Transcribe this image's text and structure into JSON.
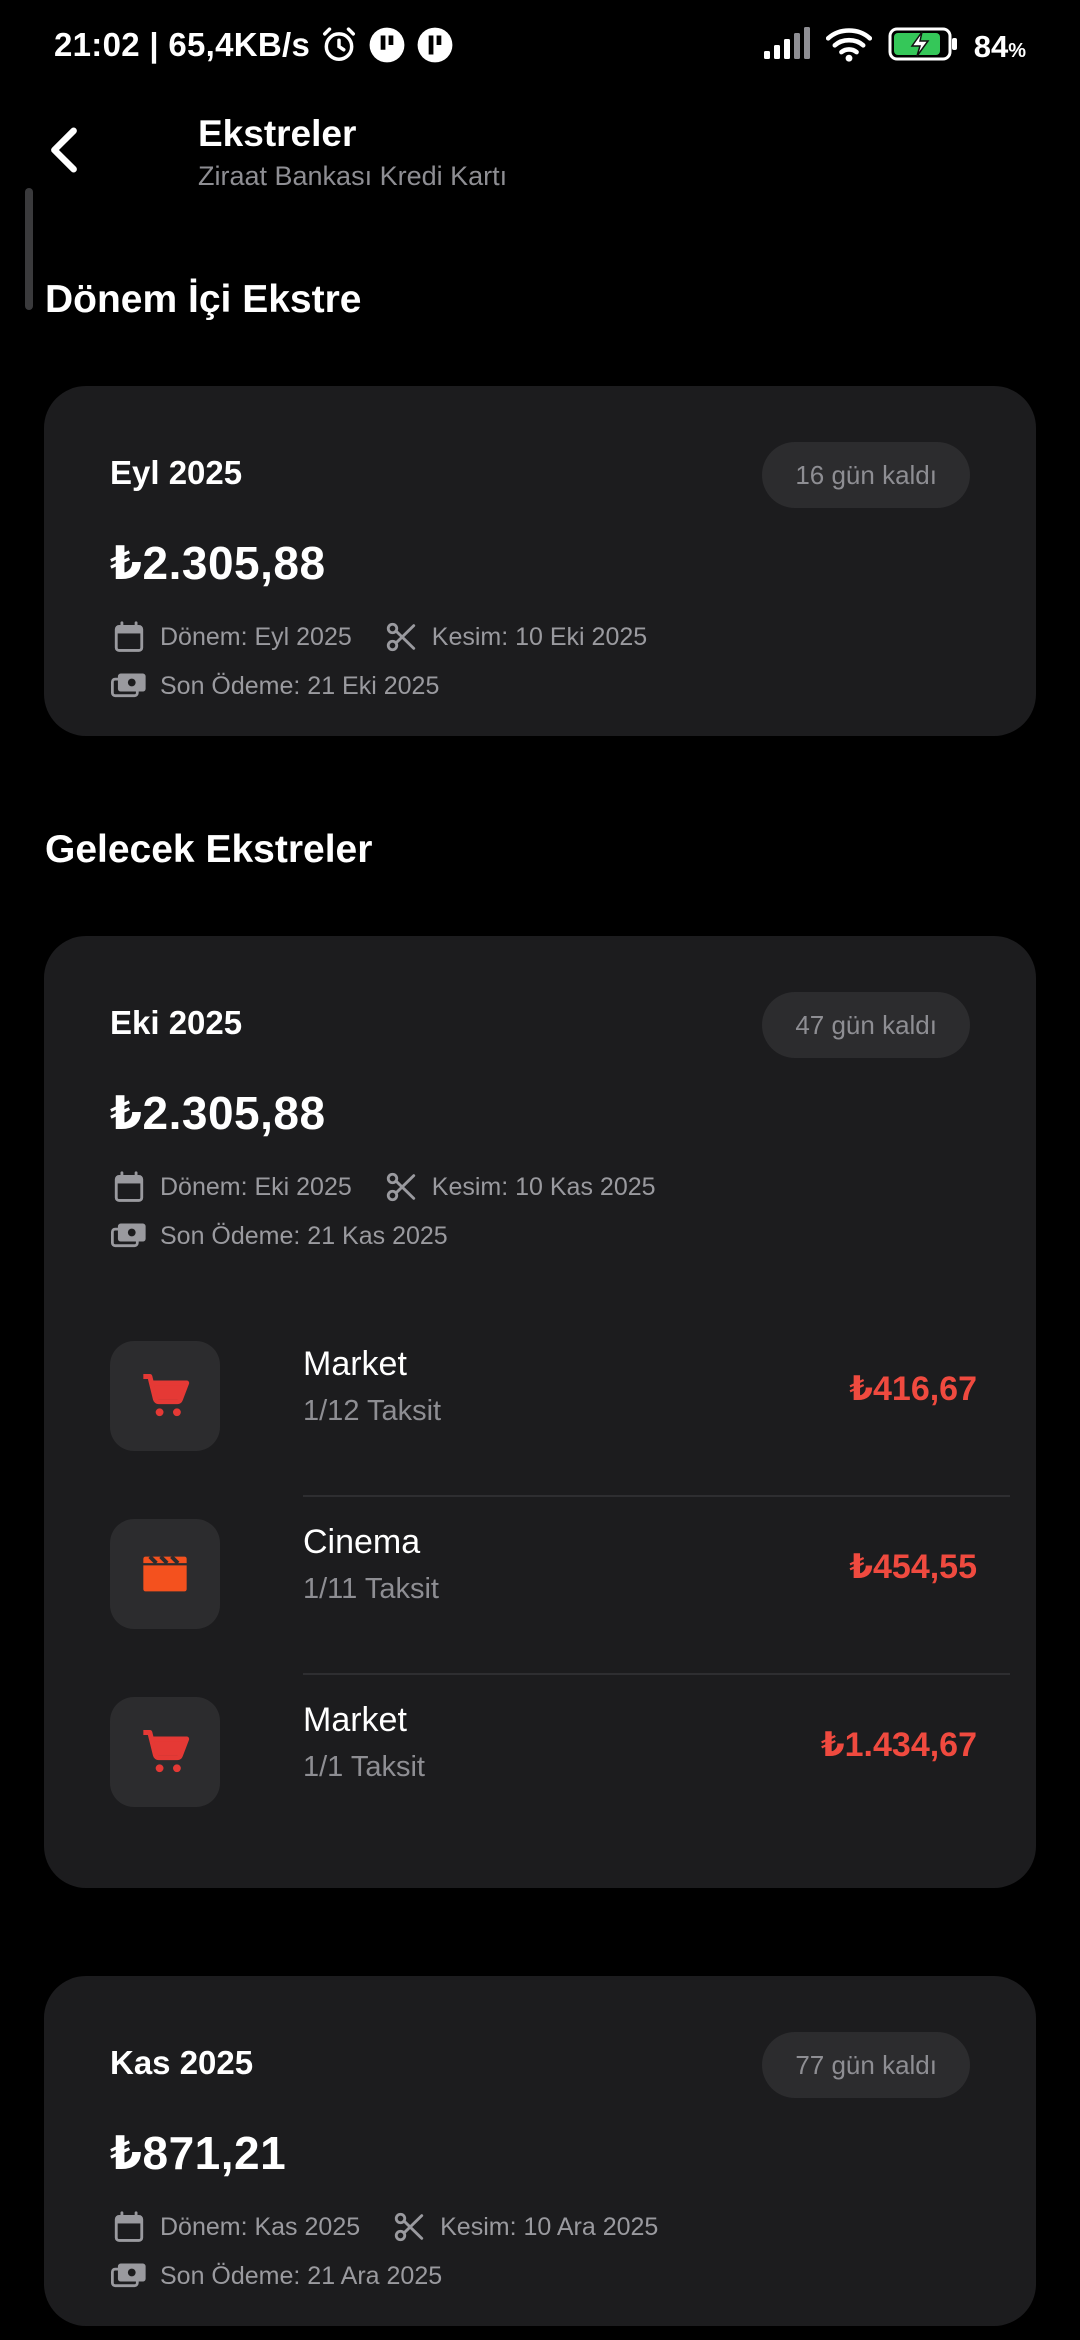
{
  "status_bar": {
    "time_speed": "21:02 | 65,4KB/s",
    "battery": "84",
    "battery_unit": "%"
  },
  "header": {
    "title": "Ekstreler",
    "subtitle": "Ziraat Bankası Kredi Kartı"
  },
  "current_section": {
    "title": "Dönem İçi Ekstre",
    "statement": {
      "period": "Eyl 2025",
      "days_left": "16 gün kaldı",
      "amount": "₺2.305,88",
      "period_line": "Dönem: Eyl 2025",
      "cutoff_line": "Kesim: 10 Eki 2025",
      "due_line": "Son Ödeme: 21 Eki 2025"
    }
  },
  "future_section": {
    "title": "Gelecek Ekstreler",
    "statements": [
      {
        "period": "Eki 2025",
        "days_left": "47 gün kaldı",
        "amount": "₺2.305,88",
        "period_line": "Dönem: Eki 2025",
        "cutoff_line": "Kesim: 10 Kas 2025",
        "due_line": "Son Ödeme: 21 Kas 2025",
        "transactions": [
          {
            "name": "Market",
            "installment": "1/12 Taksit",
            "amount": "₺416,67",
            "icon": "cart-icon",
            "icon_color": "#e53935"
          },
          {
            "name": "Cinema",
            "installment": "1/11 Taksit",
            "amount": "₺454,55",
            "icon": "movie-icon",
            "icon_color": "#f4511e"
          },
          {
            "name": "Market",
            "installment": "1/1 Taksit",
            "amount": "₺1.434,67",
            "icon": "cart-icon",
            "icon_color": "#e53935"
          }
        ]
      },
      {
        "period": "Kas 2025",
        "days_left": "77 gün kaldı",
        "amount": "₺871,21",
        "period_line": "Dönem: Kas 2025",
        "cutoff_line": "Kesim: 10 Ara 2025",
        "due_line": "Son Ödeme: 21 Ara 2025"
      }
    ]
  },
  "colors": {
    "background": "#000000",
    "card": "#1c1c1e",
    "badge": "#2c2c2e",
    "negative_amount": "#ef4a3f",
    "muted_text": "#8e8e93"
  }
}
